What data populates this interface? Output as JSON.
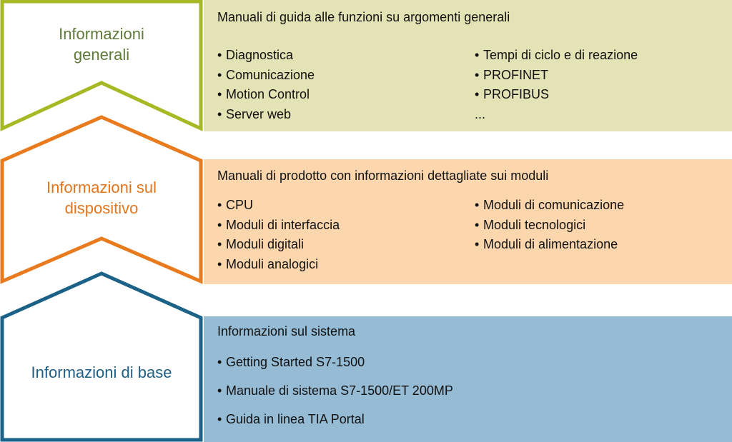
{
  "colors": {
    "general_stroke": "#a6b925",
    "general_text": "#5f7a3a",
    "general_panel": "#e4e3b6",
    "device_stroke": "#e87b1e",
    "device_text": "#e2761f",
    "device_panel": "#fcd7ae",
    "base_stroke": "#1c6288",
    "base_text": "#1d5f86",
    "base_panel": "#95bcd4"
  },
  "levels": [
    {
      "label": "Informazioni\ngenerali",
      "heading": "Manuali di guida alle funzioni su argomenti generali",
      "left_items": [
        "Diagnostica",
        "Comunicazione",
        "Motion Control",
        "Server web"
      ],
      "right_items": [
        "Tempi di ciclo e di reazione",
        "PROFINET",
        "PROFIBUS"
      ],
      "right_more": "..."
    },
    {
      "label": "Informazioni sul\ndispositivo",
      "heading": "Manuali di prodotto con informazioni dettagliate sui moduli",
      "left_items": [
        "CPU",
        "Moduli di interfaccia",
        "Moduli digitali",
        "Moduli analogici"
      ],
      "right_items": [
        "Moduli di comunicazione",
        "Moduli tecnologici",
        "Moduli di alimentazione"
      ]
    },
    {
      "label": "Informazioni di base",
      "heading": "Informazioni sul sistema",
      "left_items": [
        "Getting Started S7-1500",
        "Manuale di sistema S7-1500/ET 200MP",
        "Guida in linea TIA Portal"
      ]
    }
  ]
}
